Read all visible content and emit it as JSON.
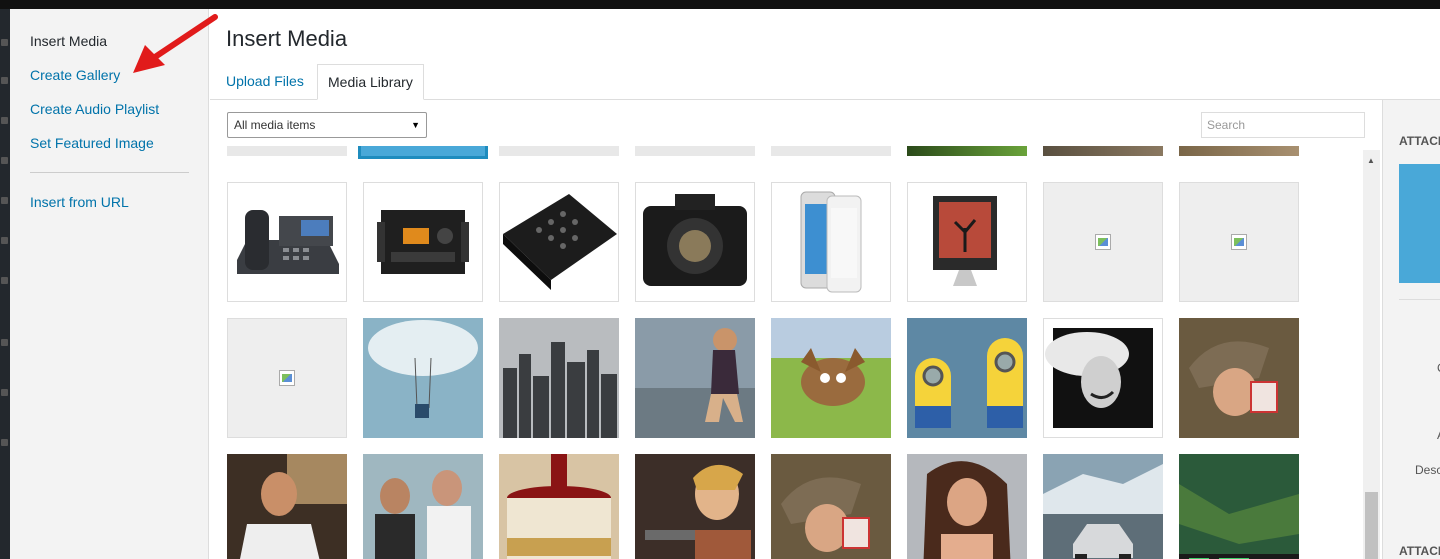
{
  "menu": {
    "items": [
      {
        "label": "Insert Media",
        "active": true
      },
      {
        "label": "Create Gallery",
        "active": false
      },
      {
        "label": "Create Audio Playlist",
        "active": false
      },
      {
        "label": "Set Featured Image",
        "active": false
      },
      {
        "label": "Insert from URL",
        "active": false
      }
    ]
  },
  "frame": {
    "title": "Insert Media",
    "tabs": [
      {
        "label": "Upload Files",
        "active": false
      },
      {
        "label": "Media Library",
        "active": true
      }
    ]
  },
  "toolbar": {
    "filter_value": "All media items",
    "search_placeholder": "Search"
  },
  "attachments": {
    "row1": [
      "desk-phone",
      "audio-recorder",
      "dj-mixer",
      "dslr-camera",
      "smartphone",
      "desktop-monitor",
      "broken-image",
      "broken-image"
    ],
    "row2": [
      "broken-image",
      "girl-on-swing",
      "city-skyline",
      "woman-sitting",
      "cartoon-creature",
      "minions",
      "woman-in-hat",
      "child-with-cup"
    ],
    "row3": [
      "man-in-car",
      "two-men",
      "paint-can",
      "cartoon-archer",
      "child-with-cup",
      "woman-portrait",
      "race-car",
      "game-screenshot"
    ]
  },
  "details_sidebar": {
    "heading1": "ATTACH",
    "heading2": "ATTACH",
    "label1": "C",
    "label2": "A",
    "label3": "Desc"
  },
  "colors": {
    "link": "#0073aa",
    "selected": "#1e8cbe",
    "arrow": "#e11b1b"
  }
}
